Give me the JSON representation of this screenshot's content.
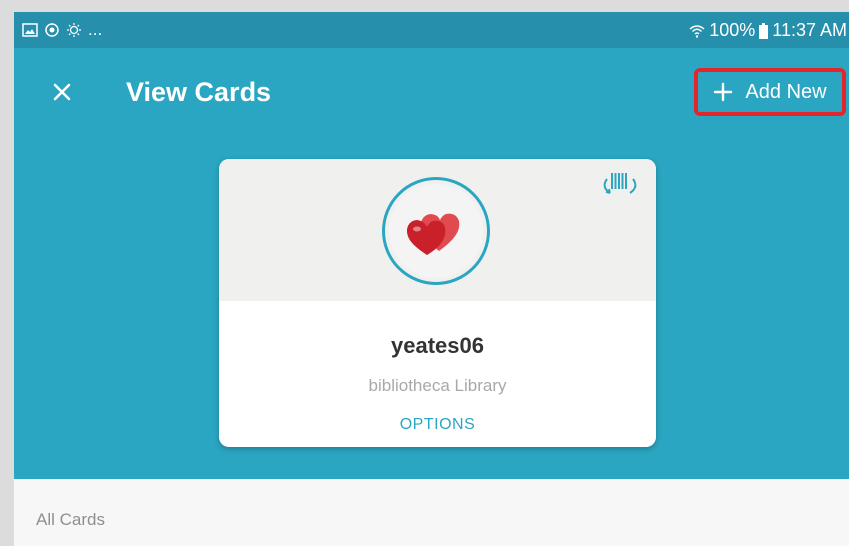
{
  "status_bar": {
    "left_ellipsis": "...",
    "battery": "100%",
    "time": "11:37 AM",
    "icons": [
      "image-icon",
      "sync-icon",
      "brightness-icon",
      "wifi-icon",
      "battery-icon"
    ]
  },
  "app_bar": {
    "title": "View Cards",
    "close_icon": "close-icon",
    "add_new_label": "Add New",
    "add_icon": "plus-icon",
    "highlight_color": "#e3262b"
  },
  "card": {
    "name": "yeates06",
    "library": "bibliotheca Library",
    "options_label": "OPTIONS",
    "avatar_icon": "hearts-icon",
    "scan_icon": "barcode-scan-icon"
  },
  "section": {
    "label": "All Cards"
  },
  "colors": {
    "primary": "#2aa6c2",
    "status_bar": "#268fab",
    "accent_text": "#2aa6c2"
  }
}
